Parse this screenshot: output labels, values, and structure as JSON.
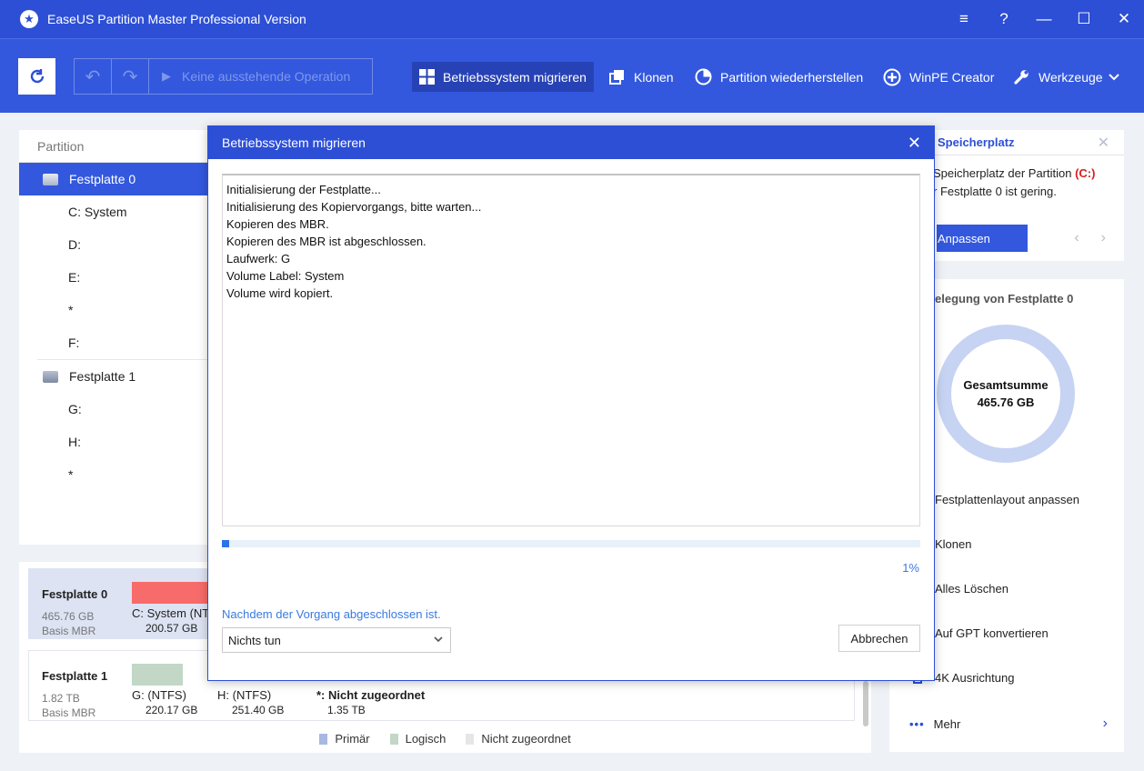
{
  "app": {
    "title": "EaseUS Partition Master Professional Version",
    "win_menu": "≡",
    "win_help": "?",
    "win_min": "—",
    "win_max": "☐",
    "win_close": "✕"
  },
  "toolbar": {
    "pending_label": "Keine ausstehende Operation",
    "buttons": [
      {
        "label": "Betriebssystem migrieren",
        "icon": "windows-icon"
      },
      {
        "label": "Klonen",
        "icon": "clone-icon"
      },
      {
        "label": "Partition wiederherstellen",
        "icon": "pie-icon"
      },
      {
        "label": "WinPE Creator",
        "icon": "plus-circle-icon"
      },
      {
        "label": "Werkzeuge",
        "icon": "wrench-icon"
      }
    ]
  },
  "partition_list": {
    "header": "Partition",
    "disk0": {
      "name": "Festplatte 0",
      "parts": [
        "C: System",
        "D:",
        "E:",
        "*",
        "F:"
      ]
    },
    "disk1": {
      "name": "Festplatte 1",
      "parts": [
        "G:",
        "H:",
        "*"
      ]
    }
  },
  "disk_map": {
    "disk0": {
      "name": "Festplatte 0",
      "size": "465.76 GB",
      "type": "Basis MBR",
      "seg_label": "C: System (NT",
      "seg_size": "200.57 GB",
      "color": "#f76b6b"
    },
    "disk1": {
      "name": "Festplatte 1",
      "size": "1.82 TB",
      "type": "Basis MBR",
      "segs": [
        {
          "label": "G: (NTFS)",
          "size": "220.17 GB"
        },
        {
          "label": "H: (NTFS)",
          "size": "251.40 GB"
        },
        {
          "label": "*: Nicht zugeordnet",
          "size": "1.35 TB"
        }
      ],
      "color": "#c2d7c6"
    },
    "legend": {
      "primary": "Primär",
      "logical": "Logisch",
      "unallocated": "Nicht zugeordnet"
    }
  },
  "notice": {
    "title": "Speicherplatz",
    "line1_prefix": "Speicherplatz der Partition ",
    "line1_drive": "(C:)",
    "line2": "r Festplatte 0 ist gering.",
    "button": "Anpassen"
  },
  "usage": {
    "title": "elegung von Festplatte 0",
    "total_label": "Gesamtsumme",
    "total_value": "465.76 GB",
    "actions": [
      "Festplattenlayout anpassen",
      "Klonen",
      "Alles Löschen",
      "Auf GPT konvertieren",
      "4K Ausrichtung"
    ],
    "more": "Mehr"
  },
  "modal": {
    "title": "Betriebssystem migrieren",
    "log": [
      "Initialisierung der Festplatte...",
      "Initialisierung des Kopiervorgangs, bitte warten...",
      "Kopieren des MBR.",
      "Kopieren des MBR ist abgeschlossen.",
      "Laufwerk: G",
      "Volume Label: System",
      "Volume wird kopiert."
    ],
    "progress_percent": 1,
    "progress_text": "1%",
    "after_label": "Nachdem der Vorgang abgeschlossen ist.",
    "after_value": "Nichts tun",
    "cancel": "Abbrechen"
  }
}
